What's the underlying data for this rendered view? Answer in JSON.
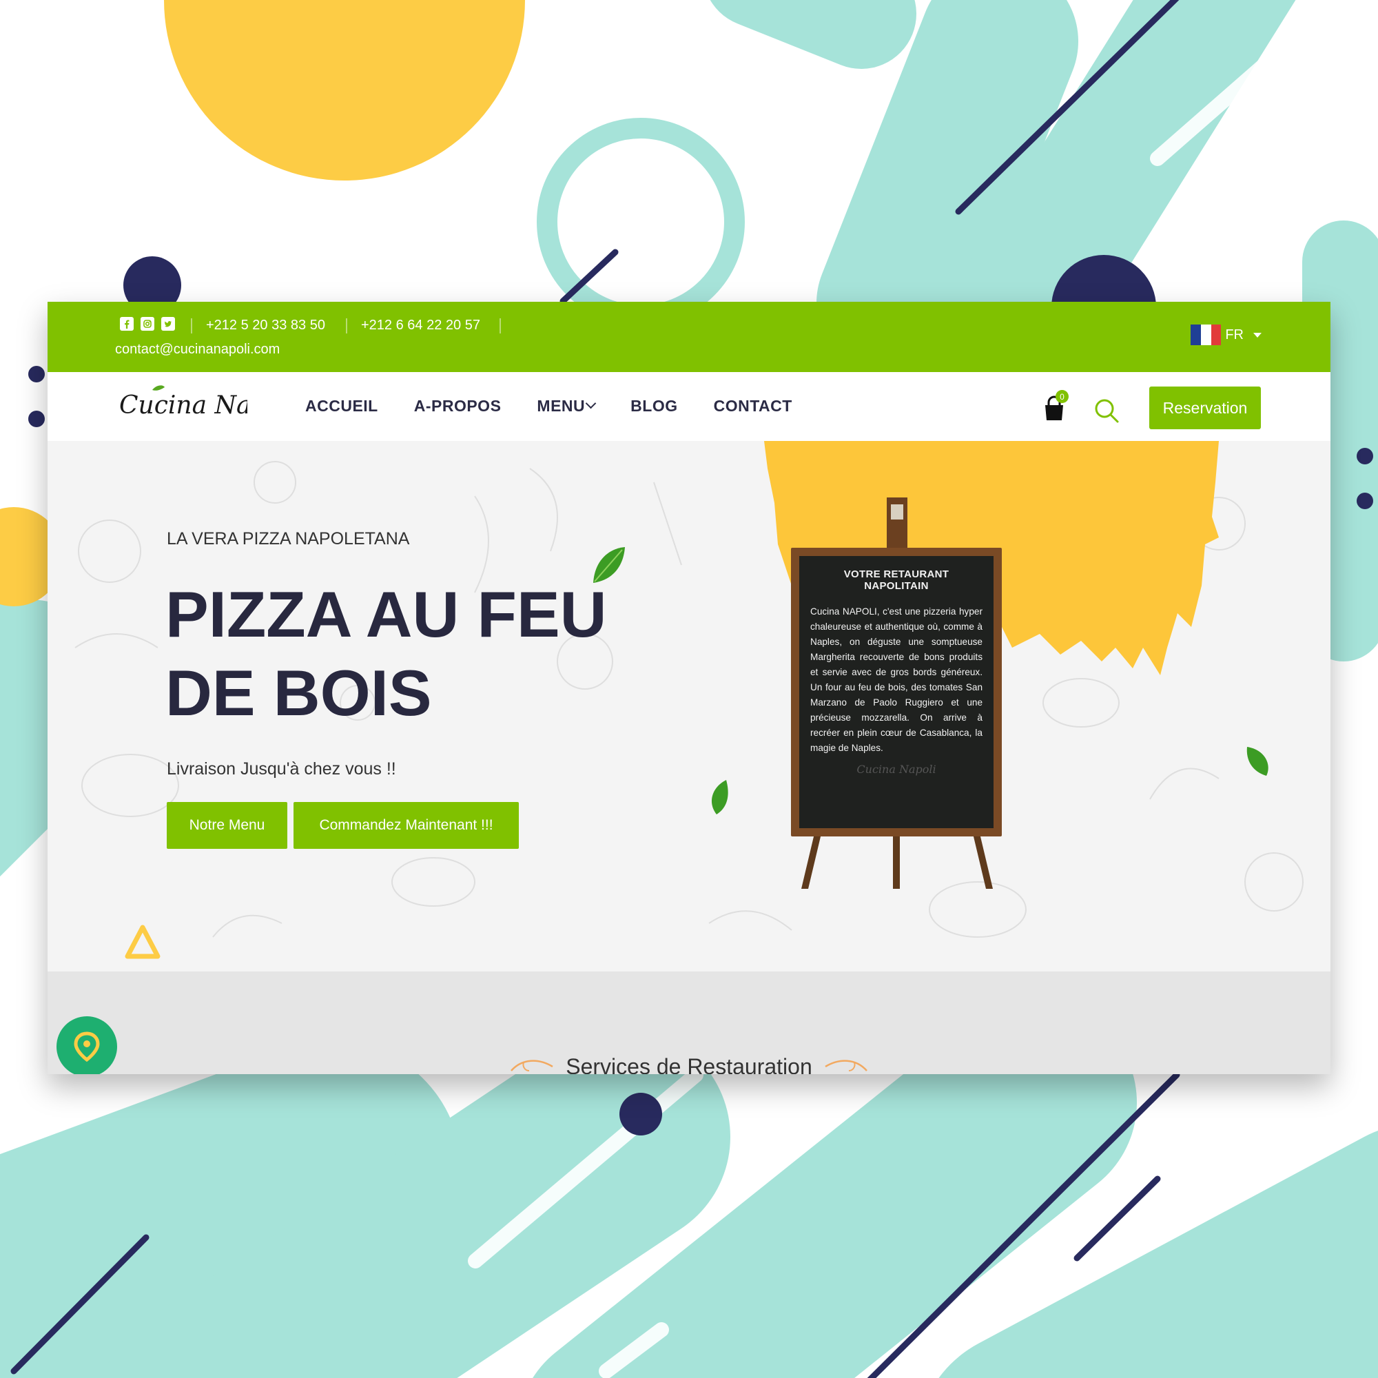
{
  "colors": {
    "brand_green": "#80c100",
    "navy": "#282a5e",
    "teal": "#a6e3d9",
    "yellow": "#fdcc45"
  },
  "topbar": {
    "social_icons": [
      "facebook-icon",
      "instagram-icon",
      "twitter-icon"
    ],
    "phone_1": "+212 5 20 33 83 50",
    "phone_2": "+212 6 64 22 20 57",
    "email": "contact@cucinanapoli.com",
    "language": "FR"
  },
  "nav": {
    "logo_text": "Cucina Napoli",
    "items": [
      {
        "label": "ACCUEIL"
      },
      {
        "label": "A-PROPOS"
      },
      {
        "label": "MENU"
      },
      {
        "label": "BLOG"
      },
      {
        "label": "CONTACT"
      }
    ],
    "cart_count": "0",
    "reservation_label": "Reservation"
  },
  "hero": {
    "subtitle": "LA VERA PIZZA NAPOLETANA",
    "headline": "PIZZA AU FEU DE BOIS",
    "tagline": "Livraison Jusqu'à chez vous !!",
    "btn_menu": "Notre Menu",
    "btn_order": "Commandez Maintenant !!!",
    "board_title": "VOTRE RETAURANT NAPOLITAIN",
    "board_text": "Cucina NAPOLI, c'est une pizzeria hyper chaleureuse et authentique où, comme à Naples, on déguste une somptueuse Margherita recouverte de bons produits et servie avec de gros bords généreux. Un four au feu de bois, des tomates San Marzano de Paolo Ruggiero et une précieuse mozzarella. On arrive à recréer en plein cœur de Casablanca, la magie de Naples.",
    "board_signature": "Cucina Napoli"
  },
  "services": {
    "title": "Services de Restauration"
  }
}
